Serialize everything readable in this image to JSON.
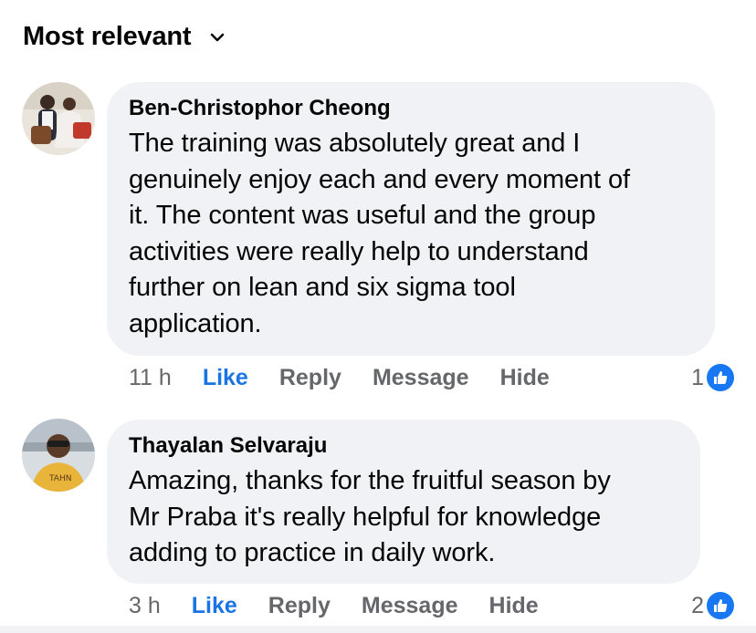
{
  "sort": {
    "label": "Most relevant",
    "icon": "chevron-down-icon"
  },
  "colors": {
    "bubble": "#f0f2f5",
    "like_blue": "#1b74e4",
    "meta_gray": "#65676b",
    "text": "#050505"
  },
  "comments": [
    {
      "author": "Ben-Christophor Cheong",
      "lines": [
        "The training was absolutely great and I",
        "genuinely enjoy each and every moment of",
        "it. The content was useful and the group",
        "activities were really help to understand",
        "further on lean and six sigma tool",
        "application."
      ],
      "time": "11 h",
      "actions": {
        "like": "Like",
        "reply": "Reply",
        "message": "Message",
        "hide": "Hide"
      },
      "reaction_count": "1",
      "reaction_icon": "thumbs-up-icon"
    },
    {
      "author": "Thayalan Selvaraju",
      "lines": [
        "Amazing, thanks for the fruitful season by",
        "Mr Praba it's really helpful for knowledge",
        "adding to practice in daily work."
      ],
      "time": "3 h",
      "actions": {
        "like": "Like",
        "reply": "Reply",
        "message": "Message",
        "hide": "Hide"
      },
      "reaction_count": "2",
      "reaction_icon": "thumbs-up-icon"
    }
  ]
}
